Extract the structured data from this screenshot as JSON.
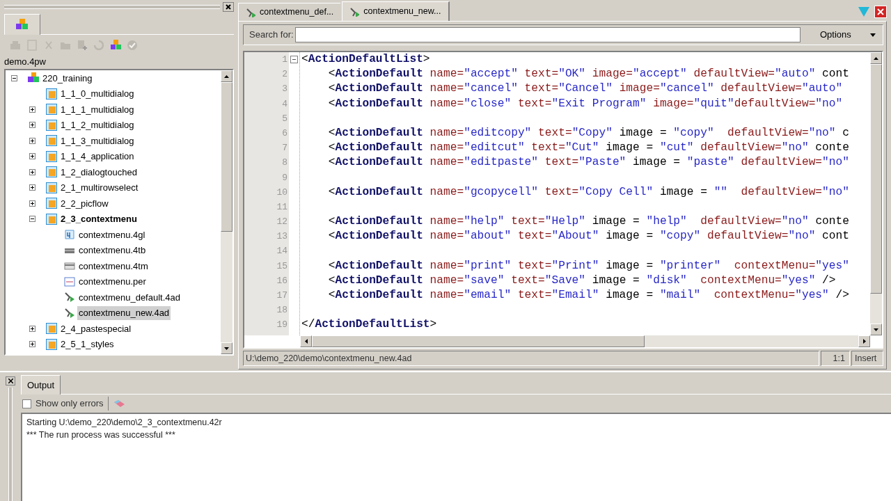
{
  "project_panel": {
    "file_label": "demo.4pw",
    "toolbar": [
      {
        "kind": "build",
        "disabled": true
      },
      {
        "kind": "page",
        "disabled": true
      },
      {
        "kind": "cut",
        "disabled": true
      },
      {
        "kind": "folder",
        "disabled": true
      },
      {
        "kind": "add",
        "disabled": true
      },
      {
        "kind": "refresh",
        "disabled": true
      },
      {
        "kind": "cubes",
        "disabled": false
      },
      {
        "kind": "check",
        "disabled": true
      }
    ],
    "tree": [
      {
        "label": "220_training",
        "kind": "project",
        "expanded": true,
        "selected": false,
        "current": false,
        "children": [
          {
            "label": "1_1_0_multidialog",
            "kind": "program",
            "selected": false,
            "current": false
          },
          {
            "label": "1_1_1_multidialog",
            "kind": "program",
            "expanded": false,
            "selected": false,
            "current": false
          },
          {
            "label": "1_1_2_multidialog",
            "kind": "program",
            "expanded": false,
            "selected": false,
            "current": false
          },
          {
            "label": "1_1_3_multidialog",
            "kind": "program",
            "expanded": false,
            "selected": false,
            "current": false
          },
          {
            "label": "1_1_4_application",
            "kind": "program",
            "expanded": false,
            "selected": false,
            "current": false
          },
          {
            "label": "1_2_dialogtouched",
            "kind": "program",
            "expanded": false,
            "selected": false,
            "current": false
          },
          {
            "label": "2_1_multirowselect",
            "kind": "program",
            "expanded": false,
            "selected": false,
            "current": false
          },
          {
            "label": "2_2_picflow",
            "kind": "program",
            "expanded": false,
            "selected": false,
            "current": false
          },
          {
            "label": "2_3_contextmenu",
            "kind": "program",
            "expanded": true,
            "selected": false,
            "current": true,
            "children": [
              {
                "label": "contextmenu.4gl",
                "kind": "source",
                "selected": false,
                "current": false
              },
              {
                "label": "contextmenu.4tb",
                "kind": "toolbar",
                "selected": false,
                "current": false
              },
              {
                "label": "contextmenu.4tm",
                "kind": "menu",
                "selected": false,
                "current": false
              },
              {
                "label": "contextmenu.per",
                "kind": "form",
                "selected": false,
                "current": false
              },
              {
                "label": "contextmenu_default.4ad",
                "kind": "actions",
                "selected": false,
                "current": false
              },
              {
                "label": "contextmenu_new.4ad",
                "kind": "actions",
                "selected": true,
                "current": false
              }
            ]
          },
          {
            "label": "2_4_pastespecial",
            "kind": "program",
            "expanded": false,
            "selected": false,
            "current": false
          },
          {
            "label": "2_5_1_styles",
            "kind": "program",
            "expanded": false,
            "selected": false,
            "current": false
          }
        ]
      }
    ]
  },
  "editor": {
    "tabs": [
      {
        "label": "contextmenu_def...",
        "selected": false
      },
      {
        "label": "contextmenu_new...",
        "selected": true
      }
    ],
    "search_label": "Search for:",
    "options_button": "Options",
    "lines": [
      {
        "number": "1",
        "text": "<ActionDefaultList>"
      },
      {
        "number": "2",
        "text": "    <ActionDefault name=\"accept\" text=\"OK\" image=\"accept\" defaultView=\"auto\" cont"
      },
      {
        "number": "3",
        "text": "    <ActionDefault name=\"cancel\" text=\"Cancel\" image=\"cancel\" defaultView=\"auto\""
      },
      {
        "number": "4",
        "text": "    <ActionDefault name=\"close\" text=\"Exit Program\" image=\"quit\"defaultView=\"no\""
      },
      {
        "number": "5"
      },
      {
        "number": "6",
        "text": "    <ActionDefault name=\"editcopy\" text=\"Copy\" image = \"copy\"  defaultView=\"no\" c"
      },
      {
        "number": "7",
        "text": "    <ActionDefault name=\"editcut\" text=\"Cut\" image = \"cut\" defaultView=\"no\" conte"
      },
      {
        "number": "8",
        "text": "    <ActionDefault name=\"editpaste\" text=\"Paste\" image = \"paste\" defaultView=\"no\""
      },
      {
        "number": "9"
      },
      {
        "number": "10",
        "text": "    <ActionDefault name=\"gcopycell\" text=\"Copy Cell\" image = \"\"  defaultView=\"no\""
      },
      {
        "number": "11"
      },
      {
        "number": "12",
        "text": "    <ActionDefault name=\"help\" text=\"Help\" image = \"help\"  defaultView=\"no\" conte"
      },
      {
        "number": "13",
        "text": "    <ActionDefault name=\"about\" text=\"About\" image = \"copy\" defaultView=\"no\" cont"
      },
      {
        "number": "14"
      },
      {
        "number": "15",
        "text": "    <ActionDefault name=\"print\" text=\"Print\" image = \"printer\"  contextMenu=\"yes\""
      },
      {
        "number": "16",
        "text": "    <ActionDefault name=\"save\" text=\"Save\" image = \"disk\"  contextMenu=\"yes\" />"
      },
      {
        "number": "17",
        "text": "    <ActionDefault name=\"email\" text=\"Email\" image = \"mail\"  contextMenu=\"yes\" />"
      },
      {
        "number": "18"
      },
      {
        "number": "19",
        "text": "</ActionDefaultList>"
      }
    ],
    "status_path": "U:\\demo_220\\demo\\contextmenu_new.4ad",
    "position": "1:1",
    "mode": "Insert"
  },
  "output_panel": {
    "tab": "Output",
    "filter_label": "Show only errors",
    "filter_checked": false,
    "messages": [
      "Starting U:\\demo_220\\demo\\2_3_contextmenu.42r",
      "*** The run process was successful ***"
    ]
  }
}
